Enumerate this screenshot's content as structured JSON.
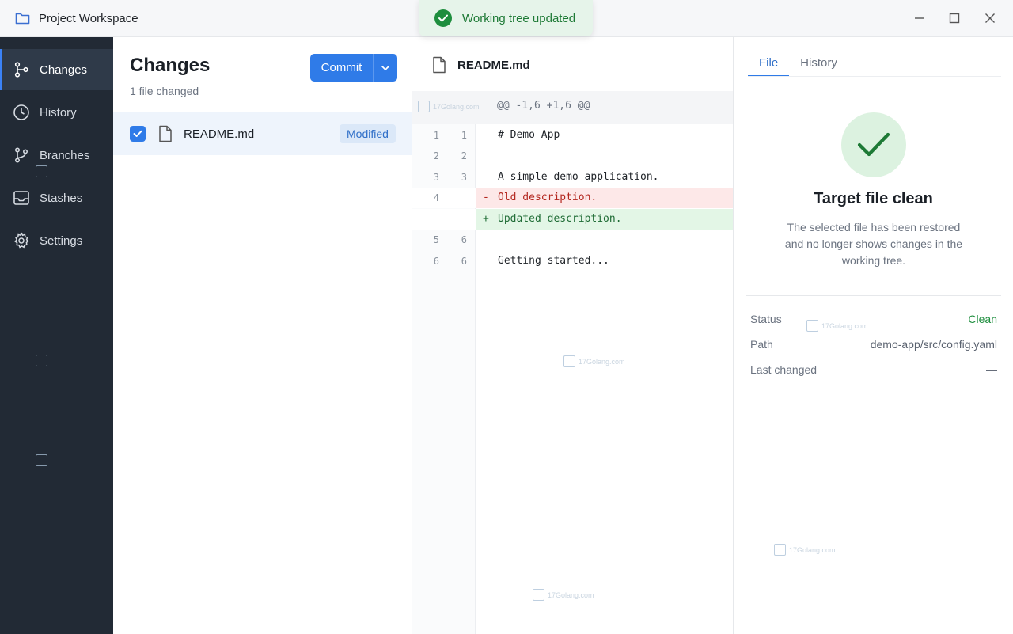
{
  "window": {
    "title": "Project Workspace"
  },
  "toast": {
    "message": "Working tree updated"
  },
  "sidebar": {
    "items": [
      {
        "label": "Changes",
        "icon": "git-commit-icon",
        "active": true
      },
      {
        "label": "History",
        "icon": "clock-icon",
        "active": false
      },
      {
        "label": "Branches",
        "icon": "branch-icon",
        "active": false
      },
      {
        "label": "Stashes",
        "icon": "inbox-icon",
        "active": false
      },
      {
        "label": "Settings",
        "icon": "gear-icon",
        "active": false
      }
    ]
  },
  "changes": {
    "title": "Changes",
    "subtitle": "1 file changed",
    "commit_label": "Commit",
    "files": [
      {
        "name": "README.md",
        "status": "Modified",
        "checked": true
      }
    ]
  },
  "diff": {
    "file_name": "README.md",
    "hunk_header": "@@ -1,6 +1,6 @@",
    "lines": [
      {
        "old": "1",
        "new": "1",
        "sign": "",
        "code": "# Demo App",
        "kind": "ctx"
      },
      {
        "old": "2",
        "new": "2",
        "sign": "",
        "code": "",
        "kind": "ctx"
      },
      {
        "old": "3",
        "new": "3",
        "sign": "",
        "code": "A simple demo application.",
        "kind": "ctx"
      },
      {
        "old": "4",
        "new": "",
        "sign": "-",
        "code": "Old description.",
        "kind": "del"
      },
      {
        "old": "",
        "new": "",
        "sign": "+",
        "code": "Updated description.",
        "kind": "add"
      },
      {
        "old": "5",
        "new": "6",
        "sign": "",
        "code": "",
        "kind": "ctx"
      },
      {
        "old": "6",
        "new": "6",
        "sign": "",
        "code": "Getting started...",
        "kind": "ctx"
      }
    ]
  },
  "details": {
    "tabs": [
      {
        "label": "File",
        "active": true
      },
      {
        "label": "History",
        "active": false
      }
    ],
    "title": "Target file clean",
    "description": "The selected file has been restored and no longer shows changes in the working tree.",
    "meta": [
      {
        "key": "Status",
        "value": "Clean"
      },
      {
        "key": "Path",
        "value": "demo-app/src/config.yaml"
      },
      {
        "key": "Last changed",
        "value": "—"
      }
    ]
  },
  "watermark": "17Golang.com",
  "colors": {
    "accent": "#2f7be8",
    "sidebar_bg": "#222a35",
    "success": "#1e8e3e",
    "deletion_bg": "#fde8e8",
    "addition_bg": "#e3f6e6"
  }
}
